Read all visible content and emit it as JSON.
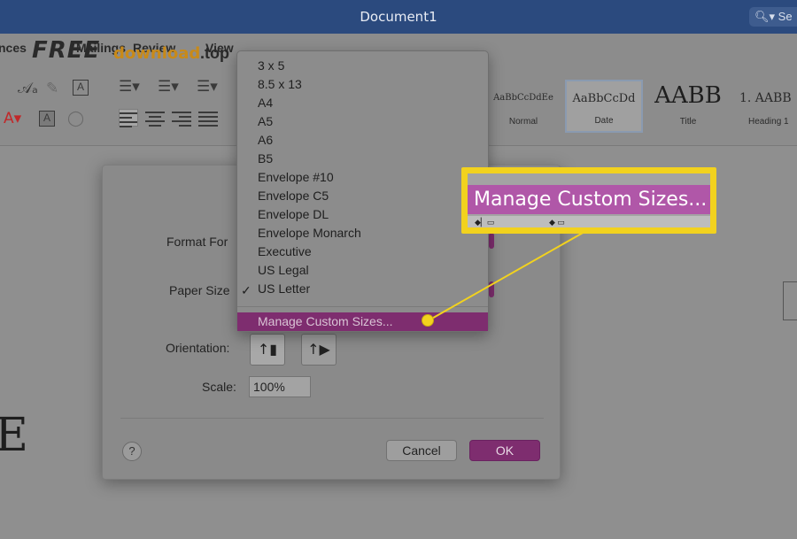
{
  "window": {
    "title": "Document1",
    "search_label": "Se"
  },
  "watermark": {
    "brand": "FREE",
    "sub": "download",
    "tld": ".top"
  },
  "ribbon": {
    "tabs": [
      "nces",
      "Mailings",
      "Review",
      "View"
    ],
    "styles": [
      {
        "sample": "AaBbCcDdEe",
        "name": "Normal"
      },
      {
        "sample": "AaBbCcDd",
        "name": "Date"
      },
      {
        "sample": "AABB",
        "name": "Title"
      },
      {
        "sample": "1. AABB",
        "name": "Heading 1"
      }
    ]
  },
  "dialog": {
    "format_for_label": "Format For",
    "paper_size_label": "Paper Size",
    "orientation_label": "Orientation:",
    "scale_label": "Scale:",
    "scale_value": "100%",
    "help_label": "?",
    "cancel_label": "Cancel",
    "ok_label": "OK"
  },
  "paper_menu": {
    "items": [
      "3 x 5",
      "8.5 x 13",
      "A4",
      "A5",
      "A6",
      "B5",
      "Envelope #10",
      "Envelope C5",
      "Envelope DL",
      "Envelope Monarch",
      "Executive",
      "US Legal",
      "US Letter"
    ],
    "selected": "US Letter",
    "check_mark": "✓",
    "manage_label": "Manage Custom Sizes..."
  },
  "callout": {
    "text": "Manage Custom Sizes..."
  },
  "document": {
    "visible_letter": "E"
  },
  "colors": {
    "titlebar": "#2b4a7e",
    "accent_purple": "#7e2d6f",
    "callout_yellow": "#f2d21e",
    "callout_band": "#b057a8"
  }
}
